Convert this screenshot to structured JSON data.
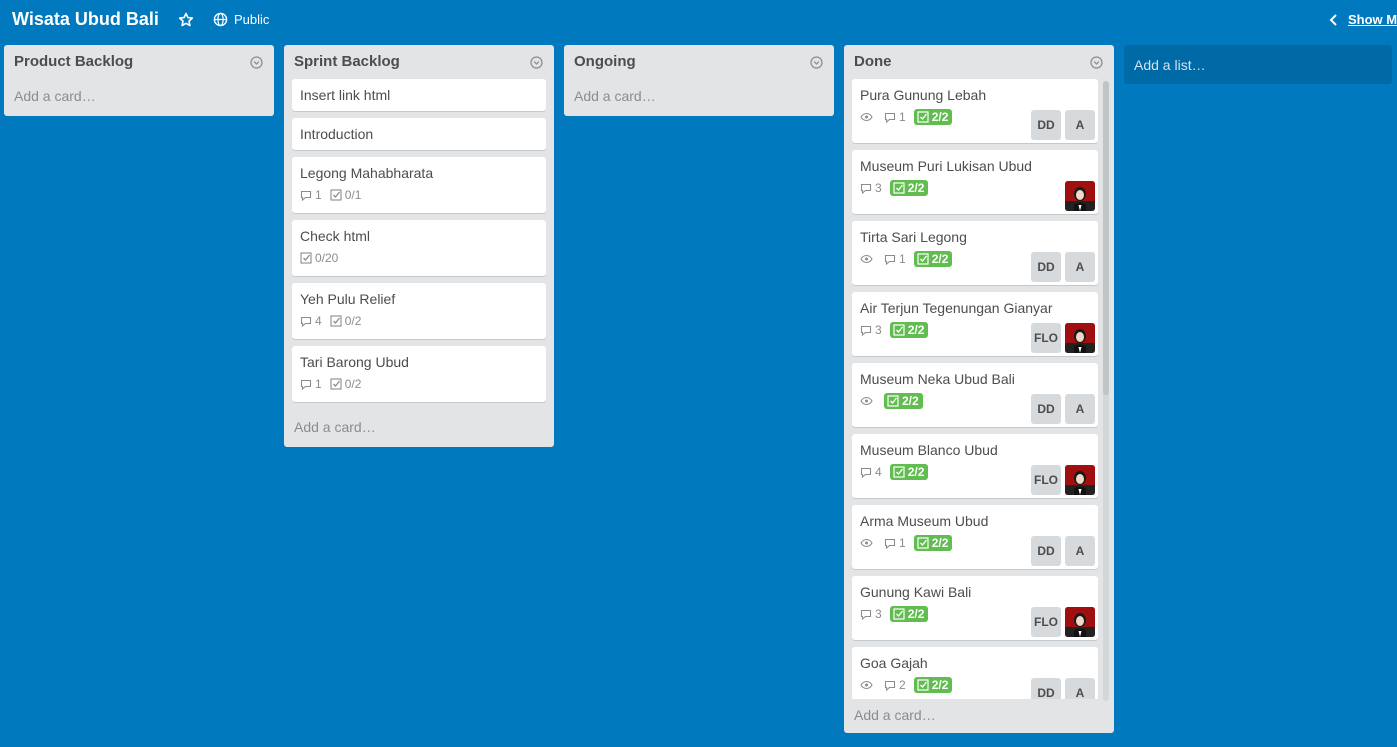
{
  "header": {
    "title": "Wisata Ubud Bali",
    "visibility": "Public",
    "show_menu": "Show Menu"
  },
  "lists": [
    {
      "title": "Product Backlog",
      "cards": [],
      "add_card": "Add a card…"
    },
    {
      "title": "Sprint Backlog",
      "cards": [
        {
          "title": "Insert link html"
        },
        {
          "title": "Introduction"
        },
        {
          "title": "Legong Mahabharata",
          "comments": "1",
          "checklist": "0/1"
        },
        {
          "title": "Check html",
          "checklist": "0/20"
        },
        {
          "title": "Yeh Pulu Relief",
          "comments": "4",
          "checklist": "0/2"
        },
        {
          "title": "Tari Barong Ubud",
          "comments": "1",
          "checklist": "0/2"
        }
      ],
      "add_card": "Add a card…"
    },
    {
      "title": "Ongoing",
      "cards": [],
      "add_card": "Add a card…"
    },
    {
      "title": "Done",
      "cards": [
        {
          "title": "Pura Gunung Lebah",
          "watch": true,
          "comments": "1",
          "checklist": "2/2",
          "members": [
            "DD",
            "A"
          ]
        },
        {
          "title": "Museum Puri Lukisan Ubud",
          "comments": "3",
          "checklist": "2/2",
          "members": [
            "avatar"
          ]
        },
        {
          "title": "Tirta Sari Legong",
          "watch": true,
          "comments": "1",
          "checklist": "2/2",
          "members": [
            "DD",
            "A"
          ]
        },
        {
          "title": "Air Terjun Tegenungan Gianyar",
          "comments": "3",
          "checklist": "2/2",
          "members": [
            "FLO",
            "avatar"
          ]
        },
        {
          "title": "Museum Neka Ubud Bali",
          "watch": true,
          "checklist": "2/2",
          "members": [
            "DD",
            "A"
          ]
        },
        {
          "title": "Museum Blanco Ubud",
          "comments": "4",
          "checklist": "2/2",
          "members": [
            "FLO",
            "avatar"
          ]
        },
        {
          "title": "Arma Museum Ubud",
          "watch": true,
          "comments": "1",
          "checklist": "2/2",
          "members": [
            "DD",
            "A"
          ]
        },
        {
          "title": "Gunung Kawi Bali",
          "comments": "3",
          "checklist": "2/2",
          "members": [
            "FLO",
            "avatar"
          ]
        },
        {
          "title": "Goa Gajah",
          "watch": true,
          "comments": "2",
          "checklist": "2/2",
          "members": [
            "DD",
            "A"
          ]
        }
      ],
      "add_card": "Add a card…"
    }
  ],
  "add_list": "Add a list…",
  "colors": {
    "board_bg": "#0079bf",
    "list_bg": "#e2e4e6",
    "checklist_done": "#61bd4f"
  }
}
